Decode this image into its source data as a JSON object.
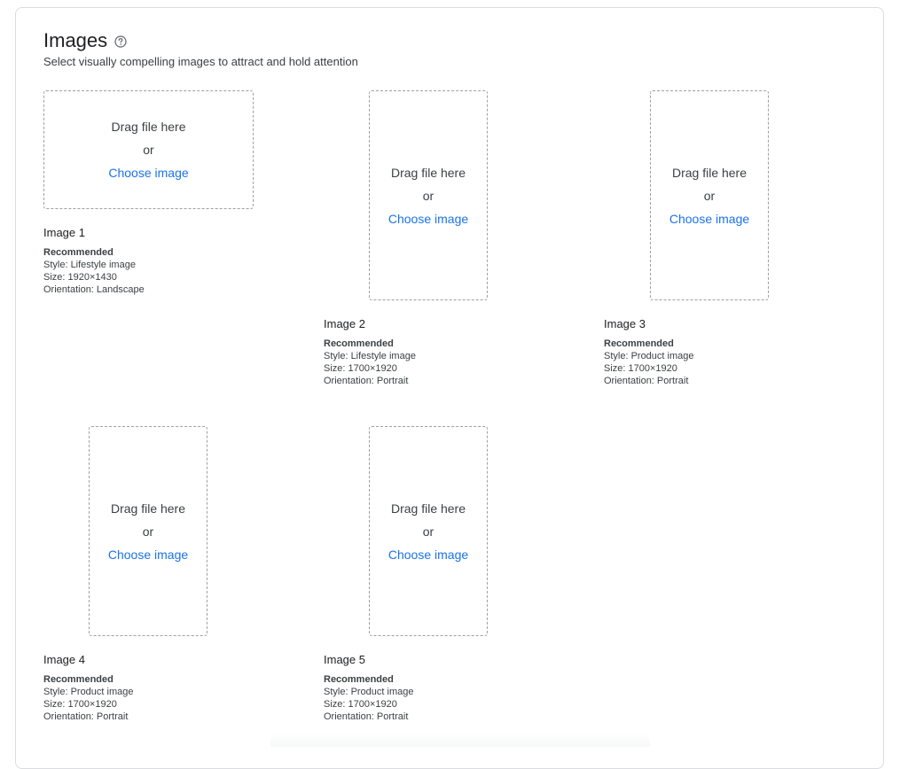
{
  "header": {
    "title": "Images",
    "subtitle": "Select visually compelling images to attract and hold attention",
    "help_icon": "help-circle-icon"
  },
  "upload": {
    "drag_text": "Drag file here",
    "or_text": "or",
    "choose_text": "Choose image"
  },
  "images": [
    {
      "name": "Image 1",
      "recommended": "Recommended",
      "style": "Style: Lifestyle image",
      "size": "Size: 1920×1430",
      "orientation": "Orientation: Landscape"
    },
    {
      "name": "Image 2",
      "recommended": "Recommended",
      "style": "Style: Lifestyle image",
      "size": "Size: 1700×1920",
      "orientation": "Orientation: Portrait"
    },
    {
      "name": "Image 3",
      "recommended": "Recommended",
      "style": "Style: Product image",
      "size": "Size: 1700×1920",
      "orientation": "Orientation: Portrait"
    },
    {
      "name": "Image 4",
      "recommended": "Recommended",
      "style": "Style: Product image",
      "size": "Size: 1700×1920",
      "orientation": "Orientation: Portrait"
    },
    {
      "name": "Image 5",
      "recommended": "Recommended",
      "style": "Style: Product image",
      "size": "Size: 1700×1920",
      "orientation": "Orientation: Portrait"
    }
  ],
  "colors": {
    "link": "#1a73e8",
    "border": "#dadce0",
    "dashed": "#9aa0a6"
  }
}
